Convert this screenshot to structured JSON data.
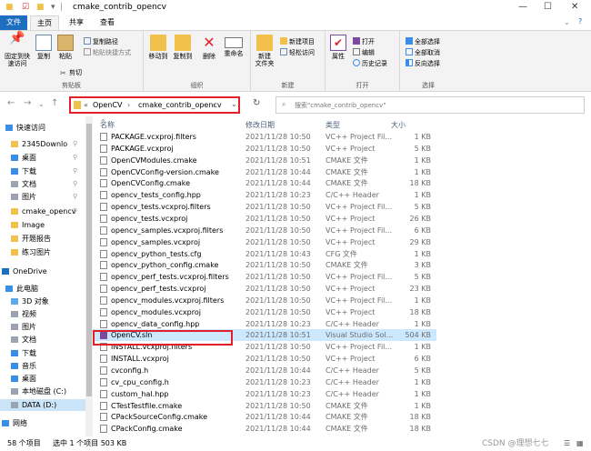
{
  "window": {
    "title": "cmake_contrib_opencv"
  },
  "menu_tabs": [
    {
      "label": "文件"
    },
    {
      "label": "主页"
    },
    {
      "label": "共享"
    },
    {
      "label": "查看"
    }
  ],
  "ribbon": {
    "clipboard": {
      "group": "剪贴板",
      "pin": "固定到快\n速访问",
      "copy": "复制",
      "paste": "粘贴",
      "copy_path": "复制路径",
      "paste_shortcut": "粘贴快捷方式",
      "cut": "剪切"
    },
    "organize": {
      "group": "组织",
      "move_to": "移动到",
      "copy_to": "复制到",
      "delete": "删除",
      "rename": "重命名"
    },
    "new": {
      "group": "新建",
      "new_folder": "新建\n文件夹",
      "new_item": "新建项目",
      "easy_access": "轻松访问"
    },
    "open": {
      "group": "打开",
      "properties": "属性",
      "open": "打开",
      "edit": "编辑",
      "history": "历史记录"
    },
    "select": {
      "group": "选择",
      "select_all": "全部选择",
      "select_none": "全部取消",
      "invert": "反向选择"
    }
  },
  "address": {
    "breadcrumb": [
      "«",
      "OpenCV",
      "›",
      "cmake_contrib_opencv",
      "›"
    ],
    "search_placeholder": "搜索\"cmake_contrib_opencv\""
  },
  "sidebar": [
    {
      "label": "快速访问",
      "color": "#3a8ee6"
    },
    {
      "label": "2345Downlo",
      "color": "#f1c14b"
    },
    {
      "label": "桌面",
      "color": "#3a8ee6"
    },
    {
      "label": "下载",
      "color": "#3a8ee6"
    },
    {
      "label": "文档",
      "color": "#9aa5b1"
    },
    {
      "label": "图片",
      "color": "#9aa5b1"
    },
    {
      "label": "cmake_opencv",
      "color": "#f1c14b"
    },
    {
      "label": "Image",
      "color": "#f1c14b"
    },
    {
      "label": "开题报告",
      "color": "#f1c14b"
    },
    {
      "label": "练习图片",
      "color": "#f1c14b"
    },
    {
      "label": "OneDrive",
      "color": "#1e6ec0"
    },
    {
      "label": "此电脑",
      "color": "#3a8ee6"
    },
    {
      "label": "3D 对象",
      "color": "#5fa8e8"
    },
    {
      "label": "视频",
      "color": "#9aa5b1"
    },
    {
      "label": "图片",
      "color": "#9aa5b1"
    },
    {
      "label": "文档",
      "color": "#9aa5b1"
    },
    {
      "label": "下载",
      "color": "#3a8ee6"
    },
    {
      "label": "音乐",
      "color": "#3a8ee6"
    },
    {
      "label": "桌面",
      "color": "#3a8ee6"
    },
    {
      "label": "本地磁盘 (C:)",
      "color": "#9aa5b1"
    },
    {
      "label": "DATA (D:)",
      "color": "#9aa5b1"
    },
    {
      "label": "网络",
      "color": "#3a8ee6"
    }
  ],
  "columns": {
    "name": "名称",
    "date": "修改日期",
    "type": "类型",
    "size": "大小"
  },
  "files": [
    {
      "name": "PACKAGE.vcxproj.filters",
      "date": "2021/11/28 10:50",
      "type": "VC++ Project Fil...",
      "size": "1 KB"
    },
    {
      "name": "PACKAGE.vcxproj",
      "date": "2021/11/28 10:50",
      "type": "VC++ Project",
      "size": "5 KB"
    },
    {
      "name": "OpenCVModules.cmake",
      "date": "2021/11/28 10:51",
      "type": "CMAKE 文件",
      "size": "1 KB"
    },
    {
      "name": "OpenCVConfig-version.cmake",
      "date": "2021/11/28 10:44",
      "type": "CMAKE 文件",
      "size": "1 KB"
    },
    {
      "name": "OpenCVConfig.cmake",
      "date": "2021/11/28 10:44",
      "type": "CMAKE 文件",
      "size": "18 KB"
    },
    {
      "name": "opencv_tests_config.hpp",
      "date": "2021/11/28 10:23",
      "type": "C/C++ Header",
      "size": "1 KB"
    },
    {
      "name": "opencv_tests.vcxproj.filters",
      "date": "2021/11/28 10:50",
      "type": "VC++ Project Fil...",
      "size": "5 KB"
    },
    {
      "name": "opencv_tests.vcxproj",
      "date": "2021/11/28 10:50",
      "type": "VC++ Project",
      "size": "26 KB"
    },
    {
      "name": "opencv_samples.vcxproj.filters",
      "date": "2021/11/28 10:50",
      "type": "VC++ Project Fil...",
      "size": "6 KB"
    },
    {
      "name": "opencv_samples.vcxproj",
      "date": "2021/11/28 10:50",
      "type": "VC++ Project",
      "size": "29 KB"
    },
    {
      "name": "opencv_python_tests.cfg",
      "date": "2021/11/28 10:43",
      "type": "CFG 文件",
      "size": "1 KB"
    },
    {
      "name": "opencv_python_config.cmake",
      "date": "2021/11/28 10:50",
      "type": "CMAKE 文件",
      "size": "3 KB"
    },
    {
      "name": "opencv_perf_tests.vcxproj.filters",
      "date": "2021/11/28 10:50",
      "type": "VC++ Project Fil...",
      "size": "5 KB"
    },
    {
      "name": "opencv_perf_tests.vcxproj",
      "date": "2021/11/28 10:50",
      "type": "VC++ Project",
      "size": "23 KB"
    },
    {
      "name": "opencv_modules.vcxproj.filters",
      "date": "2021/11/28 10:50",
      "type": "VC++ Project Fil...",
      "size": "1 KB"
    },
    {
      "name": "opencv_modules.vcxproj",
      "date": "2021/11/28 10:50",
      "type": "VC++ Project",
      "size": "18 KB"
    },
    {
      "name": "opencv_data_config.hpp",
      "date": "2021/11/28 10:23",
      "type": "C/C++ Header",
      "size": "1 KB"
    },
    {
      "name": "OpenCV.sln",
      "date": "2021/11/28 10:51",
      "type": "Visual Studio Sol...",
      "size": "504 KB"
    },
    {
      "name": "INSTALL.vcxproj.filters",
      "date": "2021/11/28 10:50",
      "type": "VC++ Project Fil...",
      "size": "1 KB"
    },
    {
      "name": "INSTALL.vcxproj",
      "date": "2021/11/28 10:50",
      "type": "VC++ Project",
      "size": "6 KB"
    },
    {
      "name": "cvconfig.h",
      "date": "2021/11/28 10:44",
      "type": "C/C++ Header",
      "size": "5 KB"
    },
    {
      "name": "cv_cpu_config.h",
      "date": "2021/11/28 10:23",
      "type": "C/C++ Header",
      "size": "1 KB"
    },
    {
      "name": "custom_hal.hpp",
      "date": "2021/11/28 10:23",
      "type": "C/C++ Header",
      "size": "1 KB"
    },
    {
      "name": "CTestTestfile.cmake",
      "date": "2021/11/28 10:50",
      "type": "CMAKE 文件",
      "size": "1 KB"
    },
    {
      "name": "CPackSourceConfig.cmake",
      "date": "2021/11/28 10:44",
      "type": "CMAKE 文件",
      "size": "18 KB"
    },
    {
      "name": "CPackConfig.cmake",
      "date": "2021/11/28 10:44",
      "type": "CMAKE 文件",
      "size": "18 KB"
    }
  ],
  "status": {
    "count": "58 个项目",
    "selected": "选中 1 个项目 503 KB"
  },
  "watermark": "CSDN @理想七七"
}
